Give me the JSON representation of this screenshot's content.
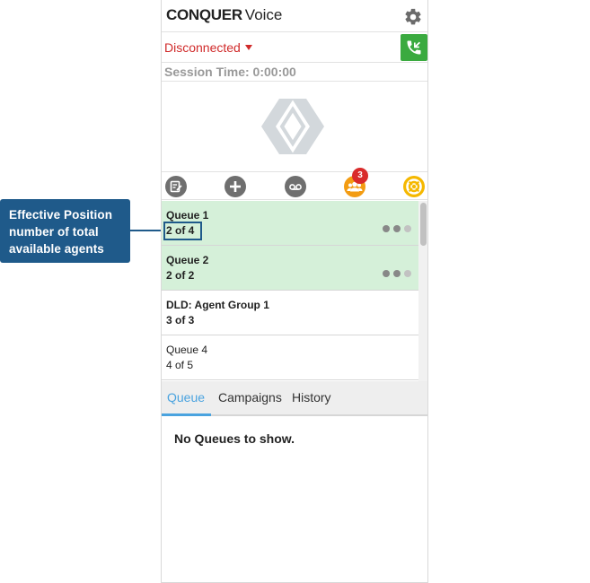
{
  "callout": {
    "lines": [
      "Effective Position",
      "number of total",
      "available agents"
    ]
  },
  "header": {
    "brand_bold": "CONQUER",
    "brand_light": "Voice"
  },
  "status": {
    "label": "Disconnected",
    "session_time": "Session Time: 0:00:00"
  },
  "toolbar": {
    "team_badge_count": "3"
  },
  "queues": [
    {
      "name": "Queue 1",
      "position": "2 of 4",
      "highlighted": true
    },
    {
      "name": "Queue 2",
      "position": "2 of 2",
      "highlighted": true
    },
    {
      "name": "DLD: Agent Group 1",
      "position": "3 of 3",
      "highlighted": false
    },
    {
      "name": "Queue 4",
      "position": "4 of 5",
      "highlighted": false
    }
  ],
  "tabs": [
    {
      "label": "Queue",
      "active": true
    },
    {
      "label": "Campaigns",
      "active": false
    },
    {
      "label": "History",
      "active": false
    }
  ],
  "empty_message": "No Queues to show.",
  "colors": {
    "callout": "#1f5a8a",
    "disconnected": "#d02a2a",
    "call_button": "#3aaa3f",
    "queue_highlight": "#d5f0d9",
    "badge": "#d92b2b",
    "active_tab": "#4aa3df",
    "team_icon": "#f39c12",
    "help_icon": "#f5b800"
  }
}
